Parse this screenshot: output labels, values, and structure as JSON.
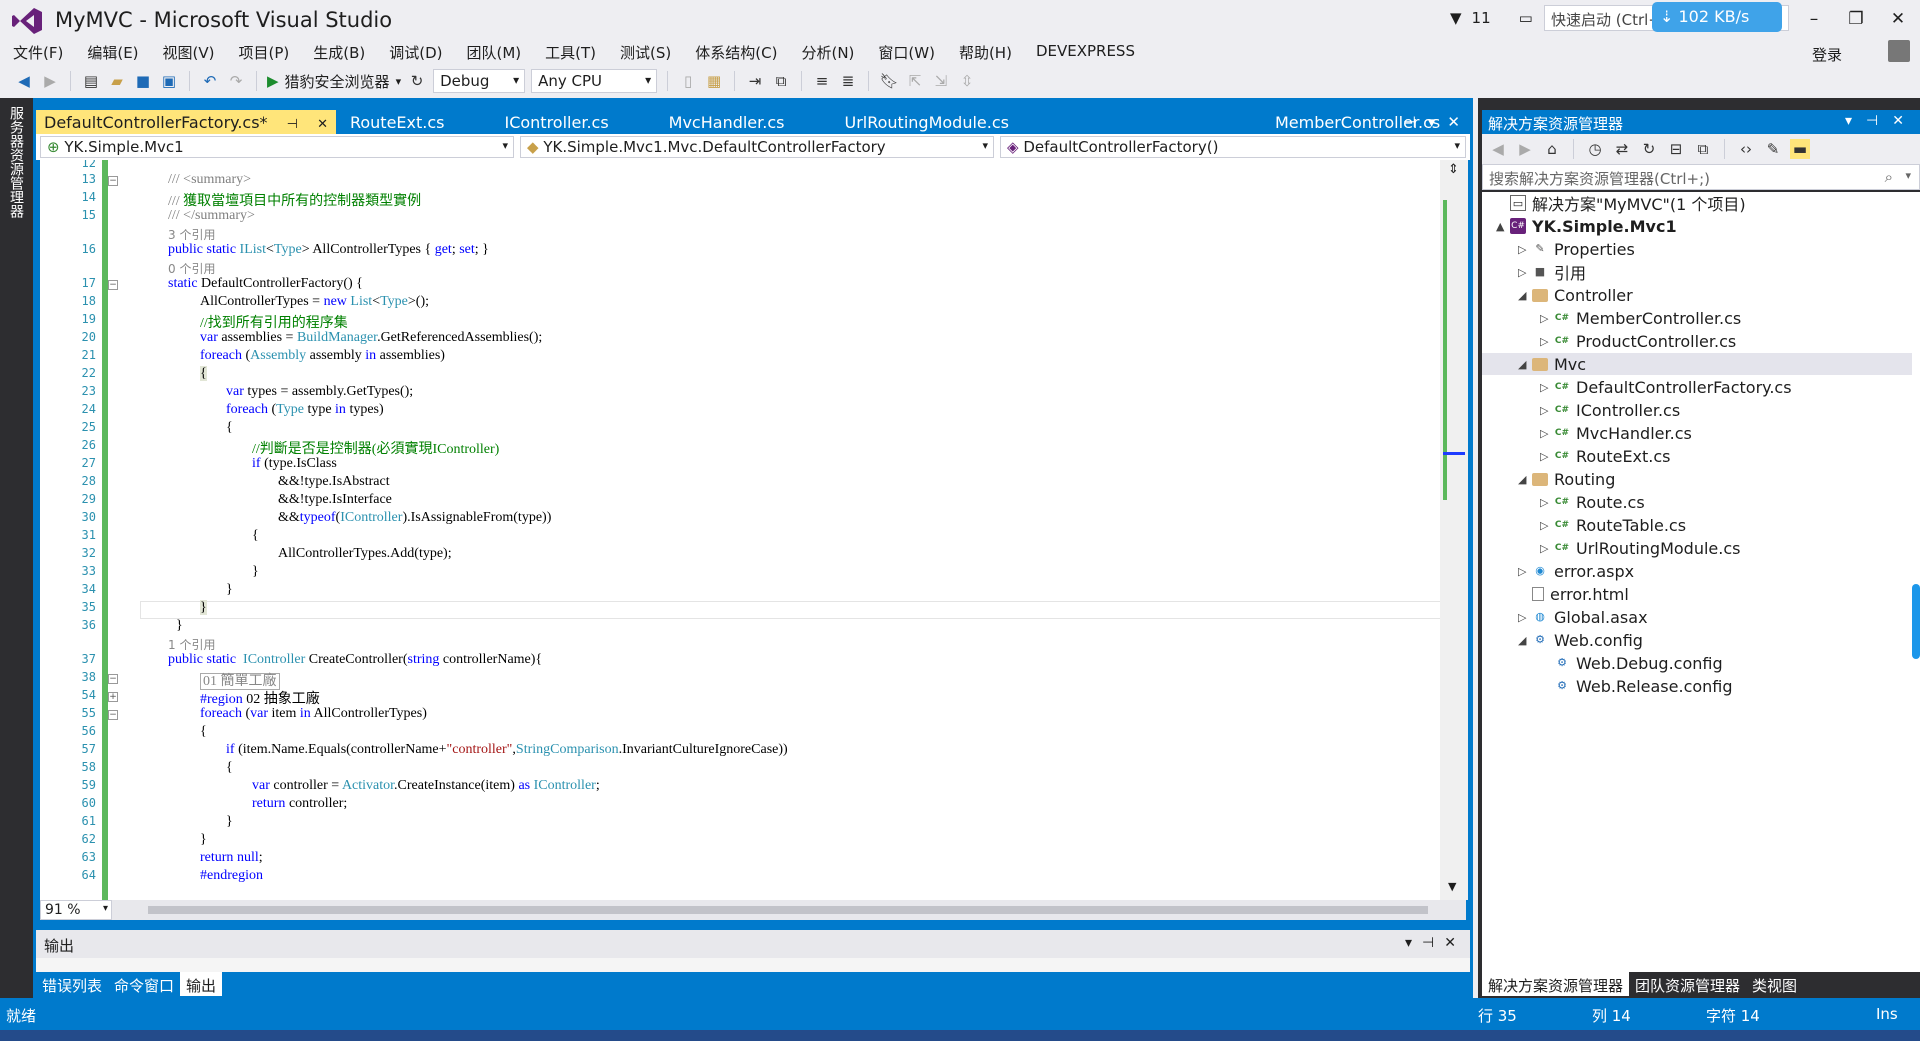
{
  "window": {
    "title": "MyMVC - Microsoft Visual Studio",
    "notifications": "11",
    "quick_launch_placeholder": "快速启动 (Ctrl+",
    "download_speed": "102 KB/s",
    "login": "登录"
  },
  "menu": [
    "文件(F)",
    "编辑(E)",
    "视图(V)",
    "项目(P)",
    "生成(B)",
    "调试(D)",
    "团队(M)",
    "工具(T)",
    "测试(S)",
    "体系结构(C)",
    "分析(N)",
    "窗口(W)",
    "帮助(H)",
    "DEVEXPRESS"
  ],
  "toolbar": {
    "run_label": "猎豹安全浏览器",
    "config": "Debug",
    "platform": "Any CPU"
  },
  "sidebar": {
    "server_explorer": "服务器资源管理器"
  },
  "doc_tabs": [
    {
      "label": "DefaultControllerFactory.cs*",
      "active": true
    },
    {
      "label": "RouteExt.cs",
      "active": false
    },
    {
      "label": "IController.cs",
      "active": false
    },
    {
      "label": "MvcHandler.cs",
      "active": false
    },
    {
      "label": "UrlRoutingModule.cs",
      "active": false
    },
    {
      "label": "MemberController.cs",
      "active": false
    }
  ],
  "nav": {
    "project": "YK.Simple.Mvc1",
    "type": "YK.Simple.Mvc1.Mvc.DefaultControllerFactory",
    "member": "DefaultControllerFactory()"
  },
  "code": {
    "line_numbers": [
      "12",
      "13",
      "14",
      "15",
      "16",
      "17",
      "18",
      "19",
      "20",
      "21",
      "22",
      "23",
      "24",
      "25",
      "26",
      "27",
      "28",
      "29",
      "30",
      "31",
      "32",
      "33",
      "34",
      "35",
      "36",
      "37",
      "38",
      "54",
      "55",
      "56",
      "57",
      "58",
      "59",
      "60",
      "61",
      "62",
      "63",
      "64"
    ],
    "l13": "/// <summary>",
    "l14": "獲取當壇項目中所有的控制器類型實例",
    "l15": "/// </summary>",
    "lens1": "3 个引用",
    "l16_a": "public static ",
    "l16_b": "IList",
    "l16_c": "<",
    "l16_d": "Type",
    "l16_e": "> AllControllerTypes { ",
    "l16_f": "get",
    "l16_g": "; ",
    "l16_h": "set",
    "l16_i": "; }",
    "lens2": "0 个引用",
    "l17_a": "static",
    "l17_b": " DefaultControllerFactory() {",
    "l18_a": "AllControllerTypes = ",
    "l18_b": "new ",
    "l18_c": "List",
    "l18_d": "<",
    "l18_e": "Type",
    "l18_f": ">();",
    "l19": "//找到所有引用的程序集",
    "l20_a": "var",
    "l20_b": " assemblies = ",
    "l20_c": "BuildManager",
    "l20_d": ".GetReferencedAssemblies();",
    "l21_a": "foreach",
    "l21_b": " (",
    "l21_c": "Assembly",
    "l21_d": " assembly ",
    "l21_e": "in",
    "l21_f": " assemblies)",
    "brace_open": "{",
    "brace_close": "}",
    "l23_a": "var",
    "l23_b": " types = assembly.GetTypes();",
    "l24_a": "foreach",
    "l24_b": " (",
    "l24_c": "Type",
    "l24_d": " type ",
    "l24_e": "in",
    "l24_f": " types)",
    "l26": "//判斷是否是控制器(必須實現IController)",
    "l27_a": "if",
    "l27_b": " (type.IsClass",
    "l28": "&&!type.IsAbstract",
    "l29": "&&!type.IsInterface",
    "l30_a": "&&",
    "l30_b": "typeof",
    "l30_c": "(",
    "l30_d": "IController",
    "l30_e": ").IsAssignableFrom(type))",
    "l32": "AllControllerTypes.Add(type);",
    "lens3": "1 个引用",
    "l37_a": "public static  ",
    "l37_b": "IController",
    "l37_c": " CreateController(",
    "l37_d": "string",
    "l37_e": " controllerName){",
    "l38": "01 簡單工廠",
    "l54_a": "#region",
    "l54_b": " 02 抽象工廠",
    "l55_a": "foreach",
    "l55_b": " (",
    "l55_c": "var",
    "l55_d": " item ",
    "l55_e": "in",
    "l55_f": " AllControllerTypes)",
    "l57_a": "if",
    "l57_b": " (item.Name.Equals(controllerName+",
    "l57_c": "\"controller\"",
    "l57_d": ",",
    "l57_e": "StringComparison",
    "l57_f": ".InvariantCultureIgnoreCase))",
    "l59_a": "var",
    "l59_b": " controller = ",
    "l59_c": "Activator",
    "l59_d": ".CreateInstance(item) ",
    "l59_e": "as",
    "l59_f": " ",
    "l59_g": "IController",
    "l59_h": ";",
    "l60_a": "return",
    "l60_b": " controller;",
    "l63_a": "return",
    "l63_b": " ",
    "l63_c": "null",
    "l63_d": ";",
    "l64": "#endregion"
  },
  "zoom": "91 %",
  "output": {
    "title": "输出",
    "tabs": [
      {
        "label": "错误列表",
        "active": false
      },
      {
        "label": "命令窗口",
        "active": false
      },
      {
        "label": "输出",
        "active": true
      }
    ]
  },
  "solution_explorer": {
    "title": "解决方案资源管理器",
    "search_placeholder": "搜索解决方案资源管理器(Ctrl+;)",
    "tree": [
      {
        "label": "解决方案\"MyMVC\"(1 个项目)",
        "icon": "solution-icon",
        "depth": 0,
        "expander": ""
      },
      {
        "label": "YK.Simple.Mvc1",
        "icon": "csharp-project-icon",
        "depth": 0,
        "expander": "▲",
        "bold": true
      },
      {
        "label": "Properties",
        "icon": "wrench-icon",
        "depth": 1,
        "expander": "▷"
      },
      {
        "label": "引用",
        "icon": "reference-icon",
        "depth": 1,
        "expander": "▷"
      },
      {
        "label": "Controller",
        "icon": "folder-icon",
        "depth": 1,
        "expander": "◢"
      },
      {
        "label": "MemberController.cs",
        "icon": "csharp-file-icon",
        "depth": 2,
        "expander": "▷"
      },
      {
        "label": "ProductController.cs",
        "icon": "csharp-file-icon",
        "depth": 2,
        "expander": "▷"
      },
      {
        "label": "Mvc",
        "icon": "folder-icon",
        "depth": 1,
        "expander": "◢",
        "selected": true
      },
      {
        "label": "DefaultControllerFactory.cs",
        "icon": "csharp-file-icon",
        "depth": 2,
        "expander": "▷"
      },
      {
        "label": "IController.cs",
        "icon": "csharp-file-icon",
        "depth": 2,
        "expander": "▷"
      },
      {
        "label": "MvcHandler.cs",
        "icon": "csharp-file-icon",
        "depth": 2,
        "expander": "▷"
      },
      {
        "label": "RouteExt.cs",
        "icon": "csharp-file-icon",
        "depth": 2,
        "expander": "▷"
      },
      {
        "label": "Routing",
        "icon": "folder-icon",
        "depth": 1,
        "expander": "◢"
      },
      {
        "label": "Route.cs",
        "icon": "csharp-file-icon",
        "depth": 2,
        "expander": "▷"
      },
      {
        "label": "RouteTable.cs",
        "icon": "csharp-file-icon",
        "depth": 2,
        "expander": "▷"
      },
      {
        "label": "UrlRoutingModule.cs",
        "icon": "csharp-file-icon",
        "depth": 2,
        "expander": "▷"
      },
      {
        "label": "error.aspx",
        "icon": "web-page-icon",
        "depth": 1,
        "expander": "▷"
      },
      {
        "label": "error.html",
        "icon": "html-file-icon",
        "depth": 1,
        "expander": ""
      },
      {
        "label": "Global.asax",
        "icon": "global-asax-icon",
        "depth": 1,
        "expander": "▷"
      },
      {
        "label": "Web.config",
        "icon": "config-file-icon",
        "depth": 1,
        "expander": "◢"
      },
      {
        "label": "Web.Debug.config",
        "icon": "config-file-icon",
        "depth": 2,
        "expander": ""
      },
      {
        "label": "Web.Release.config",
        "icon": "config-file-icon",
        "depth": 2,
        "expander": ""
      }
    ],
    "bottom_tabs": [
      {
        "label": "解决方案资源管理器",
        "active": true
      },
      {
        "label": "团队资源管理器",
        "active": false
      },
      {
        "label": "类视图",
        "active": false
      }
    ]
  },
  "status": {
    "state": "就绪",
    "line": "行 35",
    "col": "列 14",
    "char": "字符 14",
    "mode": "Ins"
  },
  "colors": {
    "accent": "#007acc",
    "active_tab": "#ffe57a",
    "keyword": "#0000ff",
    "type": "#2b91af",
    "comment": "#008000"
  }
}
